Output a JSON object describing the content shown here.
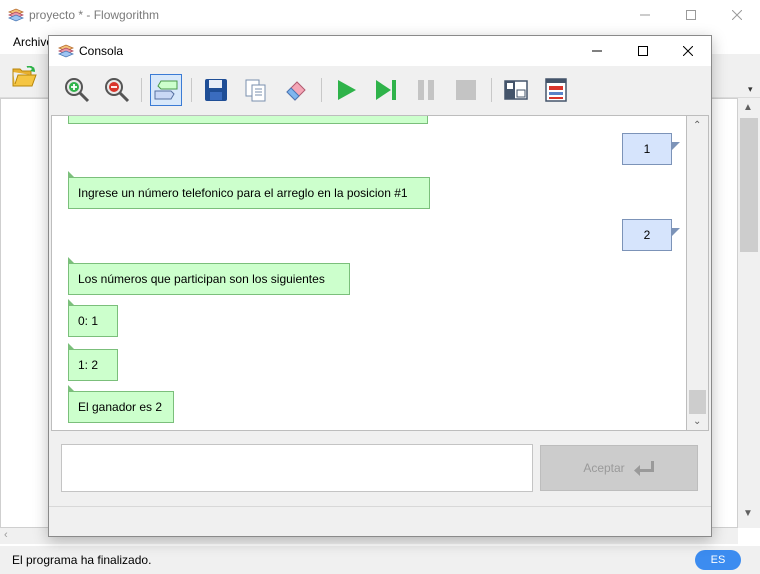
{
  "main_window": {
    "title": "proyecto * - Flowgorithm",
    "menu": {
      "archivo": "Archivo"
    },
    "status": "El programa ha finalizado.",
    "language": "ES"
  },
  "console": {
    "title": "Consola",
    "messages": [
      {
        "side": "out",
        "text": ""
      },
      {
        "side": "in",
        "text": "1"
      },
      {
        "side": "out",
        "text": "Ingrese un número telefonico para el arreglo en la posicion #1"
      },
      {
        "side": "in",
        "text": "2"
      },
      {
        "side": "out",
        "text": "Los números que participan son los siguientes"
      },
      {
        "side": "out",
        "text": "0: 1"
      },
      {
        "side": "out",
        "text": "1: 2"
      },
      {
        "side": "out",
        "text": "El ganador es 2"
      }
    ],
    "input_value": "",
    "accept_label": "Aceptar"
  },
  "icons": {
    "zoom_in": "zoom-in-icon",
    "zoom_out": "zoom-out-icon",
    "chat_view": "chat-view-icon",
    "save": "save-icon",
    "copy": "copy-icon",
    "clear": "eraser-icon",
    "run": "play-icon",
    "step": "step-icon",
    "pause": "pause-icon",
    "stop": "stop-icon",
    "layout_split": "layout-split-icon",
    "layout_stack": "layout-stack-icon"
  },
  "colors": {
    "output_bubble": "#ccffcc",
    "input_bubble": "#d6e4fc",
    "run_green": "#2fb34a",
    "badge_blue": "#3c8cf0"
  }
}
